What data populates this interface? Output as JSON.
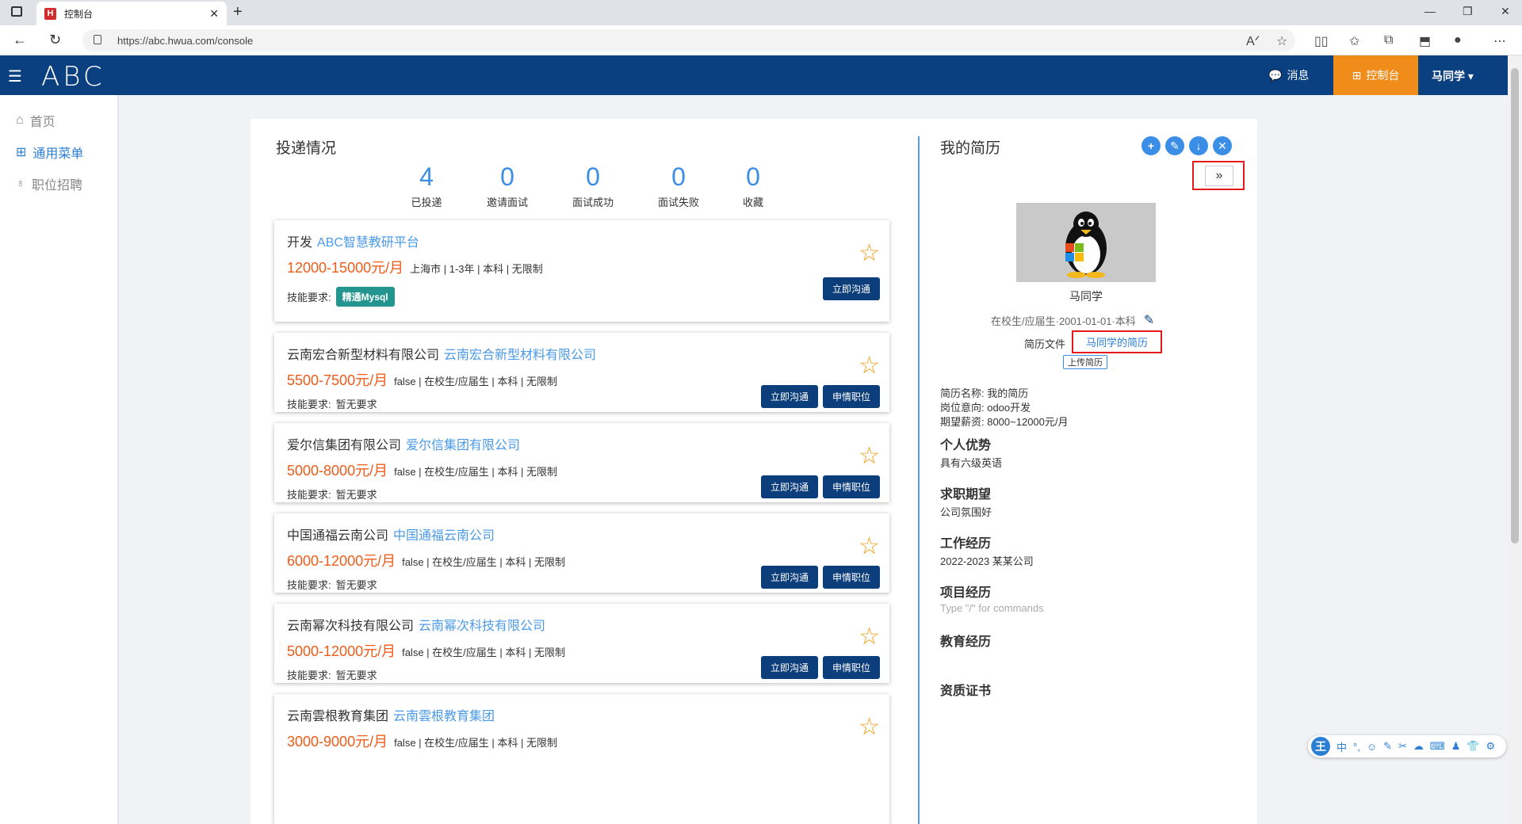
{
  "browser": {
    "tab_title": "控制台",
    "favicon_letter": "H",
    "url": "https://abc.hwua.com/console"
  },
  "header": {
    "logo": "ABC",
    "messages": "消息",
    "console": "控制台",
    "user": "马同学"
  },
  "sidebar": {
    "items": [
      {
        "label": "首页"
      },
      {
        "label": "通用菜单"
      },
      {
        "label": "职位招聘"
      }
    ]
  },
  "delivery": {
    "title": "投递情况",
    "stats": [
      {
        "value": "4",
        "label": "已投递"
      },
      {
        "value": "0",
        "label": "邀请面试"
      },
      {
        "value": "0",
        "label": "面试成功"
      },
      {
        "value": "0",
        "label": "面试失败"
      },
      {
        "value": "0",
        "label": "收藏"
      }
    ]
  },
  "jobs": [
    {
      "title": "开发",
      "company": "ABC智慧教研平台",
      "salary": "12000-15000元/月",
      "meta": "上海市 | 1-3年 | 本科 | 无限制",
      "skill_label": "技能要求:",
      "skill_value": "",
      "skill_tag": "精通Mysql",
      "btn_chat": "立即沟通",
      "btn_apply": ""
    },
    {
      "title": "云南宏合新型材料有限公司",
      "company": "云南宏合新型材料有限公司",
      "salary": "5500-7500元/月",
      "meta": "false | 在校生/应届生 | 本科 | 无限制",
      "skill_label": "技能要求:",
      "skill_value": "暂无要求",
      "skill_tag": "",
      "btn_chat": "立即沟通",
      "btn_apply": "申情职位"
    },
    {
      "title": "爱尔信集团有限公司",
      "company": "爱尔信集团有限公司",
      "salary": "5000-8000元/月",
      "meta": "false | 在校生/应届生 | 本科 | 无限制",
      "skill_label": "技能要求:",
      "skill_value": "暂无要求",
      "skill_tag": "",
      "btn_chat": "立即沟通",
      "btn_apply": "申情职位"
    },
    {
      "title": "中国通福云南公司",
      "company": "中国通福云南公司",
      "salary": "6000-12000元/月",
      "meta": "false | 在校生/应届生 | 本科 | 无限制",
      "skill_label": "技能要求:",
      "skill_value": "暂无要求",
      "skill_tag": "",
      "btn_chat": "立即沟通",
      "btn_apply": "申情职位"
    },
    {
      "title": "云南幂次科技有限公司",
      "company": "云南幂次科技有限公司",
      "salary": "5000-12000元/月",
      "meta": "false | 在校生/应届生 | 本科 | 无限制",
      "skill_label": "技能要求:",
      "skill_value": "暂无要求",
      "skill_tag": "",
      "btn_chat": "立即沟通",
      "btn_apply": "申情职位"
    },
    {
      "title": "云南雲根教育集团",
      "company": "云南雲根教育集团",
      "salary": "3000-9000元/月",
      "meta": "false | 在校生/应届生 | 本科 | 无限制",
      "skill_label": "",
      "skill_value": "",
      "skill_tag": "",
      "btn_chat": "",
      "btn_apply": ""
    }
  ],
  "resume": {
    "title": "我的简历",
    "toggle": "»",
    "name": "马同学",
    "status": "在校生/应届生·2001-01-01·本科",
    "file_label": "简历文件",
    "file_link": "马同学的简历",
    "upload": "上传简历",
    "info": [
      "简历名称:  我的简历",
      "岗位意向:  odoo开发",
      "期望薪资:  8000~12000元/月"
    ],
    "sections": [
      {
        "heading": "个人优势",
        "text": "具有六级英语",
        "placeholder": false
      },
      {
        "heading": "求职期望",
        "text": "公司氛围好",
        "placeholder": false
      },
      {
        "heading": "工作经历",
        "text": "2022-2023 某某公司",
        "placeholder": false
      },
      {
        "heading": "项目经历",
        "text": "Type \"/\" for commands",
        "placeholder": true
      },
      {
        "heading": "教育经历",
        "text": "",
        "placeholder": false
      },
      {
        "heading": "资质证书",
        "text": "",
        "placeholder": false
      }
    ]
  },
  "ime": {
    "logo": "王",
    "items": [
      "中",
      "°,",
      "☺",
      "✎",
      "✂",
      "☁",
      "⌨",
      "♟",
      "👕",
      "⚙"
    ]
  },
  "colors": {
    "header_bg": "#0a3f80",
    "console_bg": "#f08c1a",
    "stat_blue": "#3a8ee6",
    "salary_orange": "#f05c18",
    "star_gold": "#f0a018",
    "highlight_red": "#e4191c"
  }
}
